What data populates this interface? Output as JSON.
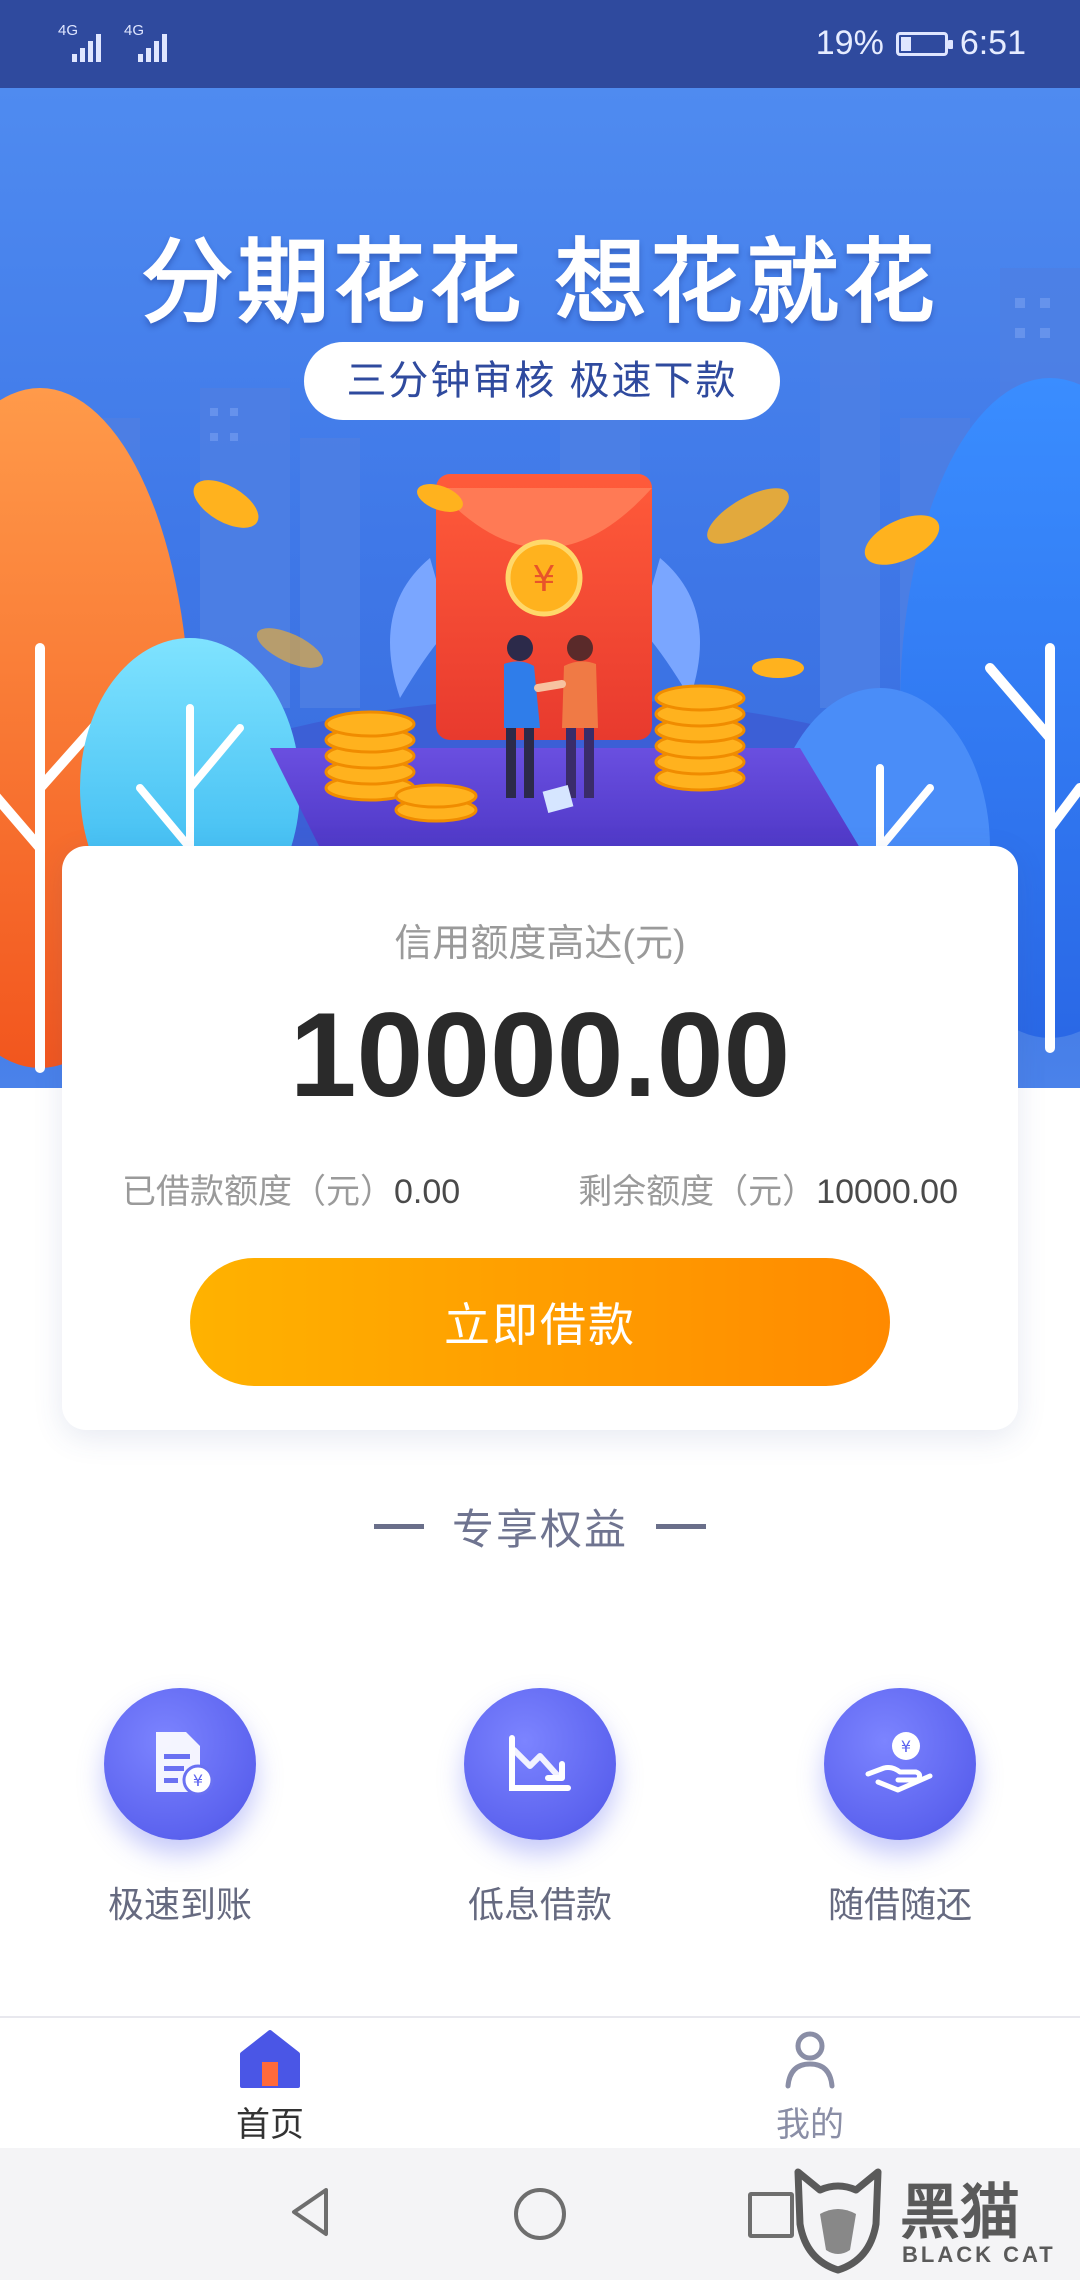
{
  "status_bar": {
    "network_1": "4G",
    "network_2": "4G",
    "battery": "19%",
    "time": "6:51"
  },
  "banner": {
    "headline": "分期花花 想花就花",
    "subtitle": "三分钟审核  极速下款",
    "envelope_symbol": "¥"
  },
  "credit": {
    "label": "信用额度高达(元)",
    "amount": "10000.00",
    "used_label": "已借款额度（元）",
    "used_value": "0.00",
    "remaining_label": "剩余额度（元）",
    "remaining_value": "10000.00",
    "borrow_button": "立即借款"
  },
  "benefits": {
    "title": "专享权益",
    "items": [
      {
        "label": "极速到账",
        "icon": "document-yuan-icon"
      },
      {
        "label": "低息借款",
        "icon": "trend-down-icon"
      },
      {
        "label": "随借随还",
        "icon": "hand-coin-icon"
      }
    ]
  },
  "bottom_nav": {
    "items": [
      {
        "label": "首页",
        "icon": "home-icon",
        "active": true
      },
      {
        "label": "我的",
        "icon": "person-icon",
        "active": false
      }
    ]
  },
  "watermark": {
    "text_cn": "黑猫",
    "text_en": "BLACK CAT"
  },
  "colors": {
    "status_bar": "#2f4a9e",
    "banner_blue": "#3f78e8",
    "button_orange": "#ff9a00",
    "benefit_purple": "#5c63ef",
    "nav_active": "#4a56e6"
  }
}
